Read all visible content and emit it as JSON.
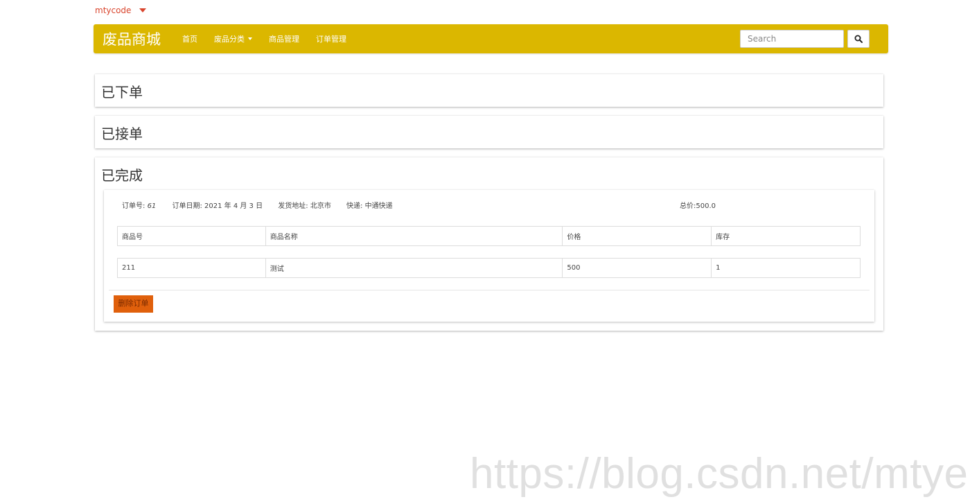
{
  "user": {
    "name": "mtycode"
  },
  "navbar": {
    "brand": "废品商城",
    "items": [
      {
        "label": "首页"
      },
      {
        "label": "废品分类"
      },
      {
        "label": "商品管理"
      },
      {
        "label": "订单管理"
      }
    ],
    "search_placeholder": "Search",
    "accent_color": "#dbb700"
  },
  "panels": {
    "ordered": {
      "title": "已下单"
    },
    "accepted": {
      "title": "已接单"
    },
    "completed": {
      "title": "已完成"
    }
  },
  "order": {
    "number_label": "订单号:",
    "number": "61",
    "date": "订单日期: 2021 年 4 月 3 日",
    "address": "发货地址: 北京市",
    "courier": "快递: 中通快递",
    "total": "总价:500.0",
    "columns": [
      "商品号",
      "商品名称",
      "价格",
      "库存"
    ],
    "rows": [
      [
        "211",
        "测试",
        "500",
        "1"
      ]
    ],
    "delete_label": "删除订单",
    "delete_color": "#e0600c"
  },
  "watermark": "https://blog.csdn.net/mtyedu"
}
